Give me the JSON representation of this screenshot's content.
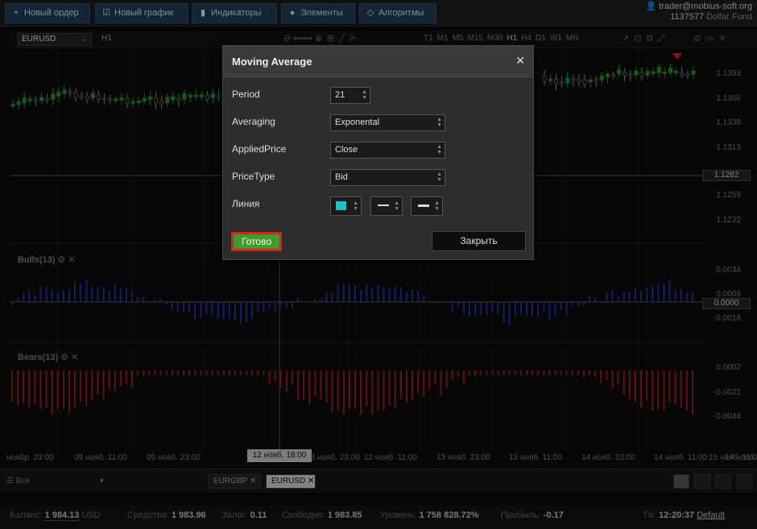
{
  "toolbar": {
    "buttons": [
      {
        "icon": "+",
        "label": "Новый ордер"
      },
      {
        "icon": "☑",
        "label": "Новый график"
      },
      {
        "icon": "▮",
        "label": "Индикаторы"
      },
      {
        "icon": "●",
        "label": "Элементы"
      },
      {
        "icon": "◇",
        "label": "Алгоритмы"
      }
    ]
  },
  "account": {
    "email": "trader@mobius-soft.org",
    "id": "1137577",
    "fund": "Dollar Fund"
  },
  "chart": {
    "symbol": "EURUSD",
    "timeframe": "H1",
    "timeframes": [
      "T1",
      "M1",
      "M5",
      "M15",
      "M30",
      "H1",
      "H4",
      "D1",
      "W1",
      "MN"
    ],
    "price_axis": [
      "1.1393",
      "1.1366",
      "1.1339",
      "1.1313",
      "1.1259",
      "1.1232"
    ],
    "price_tag": "1.1282",
    "bulls": {
      "title": "Bulls(13)",
      "axis": [
        "0.0034",
        "0.0008",
        "-0.0018"
      ],
      "tag": "0.0000"
    },
    "bears": {
      "title": "Bears(13)",
      "axis": [
        "0.0002",
        "-0.0021",
        "-0.0044"
      ]
    },
    "time_labels": [
      "ноябр. 23:00",
      "09 нояб. 11:00",
      "09 нояб. 23:00",
      "",
      "13 нояб. 23:00",
      "12 нояб. 11:00",
      "13 нояб. 23:00",
      "13 нояб. 11:00",
      "14 нояб. 23:00",
      "14 нояб. 11:00",
      "14 нояб. 23:00",
      "15 нояб. 11:00"
    ],
    "time_highlight": "12 нояб. 18:00",
    "bull_color": "#2a3bd0",
    "bear_color": "#c82020",
    "up_candle_color": "#1f8f1f"
  },
  "tabs": {
    "filter": "Все",
    "items": [
      "EURGBP",
      "EURUSD"
    ],
    "active": "EURUSD"
  },
  "status": {
    "balance_label": "Баланс:",
    "balance": "1 984.13",
    "currency": "USD",
    "equity_label": "Средства:",
    "equity": "1 983.96",
    "margin_label": "Залог:",
    "margin": "0.11",
    "free_label": "Свободно:",
    "free": "1 983.85",
    "level_label": "Уровень:",
    "level": "1 758 828.72%",
    "profit_label": "Прибыль:",
    "profit": "-0.17",
    "tick_label": "Тік:",
    "time": "12:20:37",
    "profile": "Default"
  },
  "dialog": {
    "title": "Moving Average",
    "rows": [
      {
        "label": "Period",
        "value": "21"
      },
      {
        "label": "Averaging",
        "value": "Exponental"
      },
      {
        "label": "AppliedPrice",
        "value": "Close"
      },
      {
        "label": "PriceType",
        "value": "Bid"
      },
      {
        "label": "Линия",
        "value": ""
      }
    ],
    "line_color": "#17c6cc",
    "ok_label": "Готово",
    "close_label": "Закрыть"
  }
}
